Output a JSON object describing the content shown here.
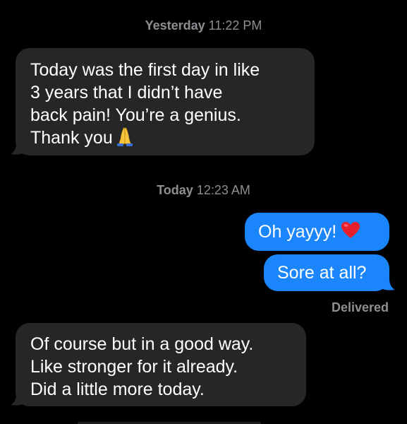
{
  "conversation": {
    "timestamps": [
      {
        "day": "Yesterday",
        "time": "11:22 PM"
      },
      {
        "day": "Today",
        "time": "12:23 AM"
      }
    ],
    "messages": [
      {
        "direction": "received",
        "lines": [
          "Today was the first day in like",
          "3 years that I didn’t have",
          "back pain! You’re a genius.",
          "Thank you"
        ],
        "emoji": "pray-icon"
      },
      {
        "direction": "sent",
        "text": "Oh yayyy!",
        "emoji": "heart-icon"
      },
      {
        "direction": "sent",
        "text": "Sore at all?"
      },
      {
        "direction": "received",
        "lines": [
          "Of course but in a good way.",
          "Like stronger for it already.",
          "Did a little more today."
        ]
      }
    ],
    "delivery_status": "Delivered"
  },
  "colors": {
    "background": "#000000",
    "received_bubble": "#262628",
    "sent_bubble": "#1b86fc",
    "meta_text": "#8e8e93"
  }
}
